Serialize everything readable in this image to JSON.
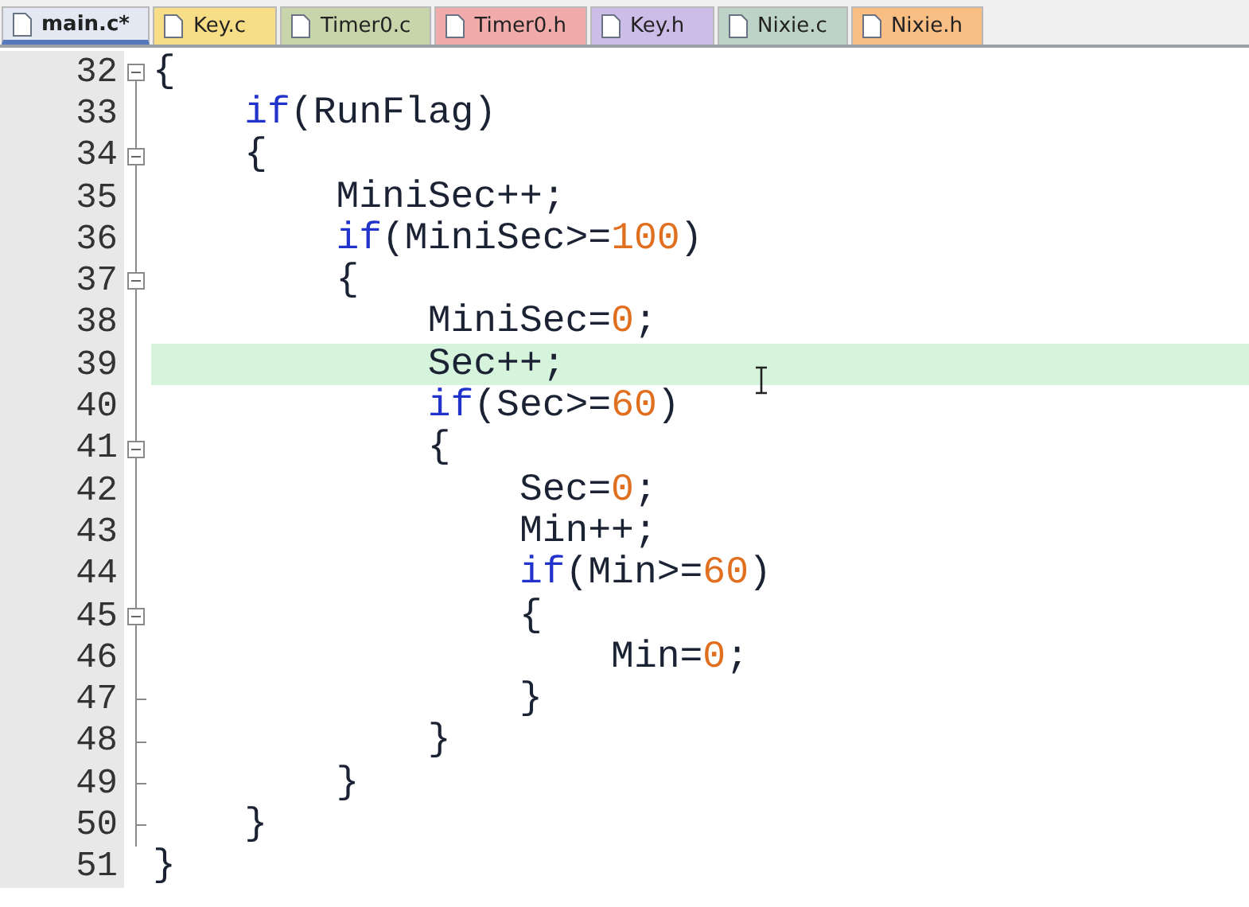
{
  "tabs": [
    {
      "label": "main.c*",
      "color": "#e3e8f3",
      "selected": true
    },
    {
      "label": "Key.c",
      "color": "#f7de86",
      "selected": false
    },
    {
      "label": "Timer0.c",
      "color": "#c8d5ab",
      "selected": false
    },
    {
      "label": "Timer0.h",
      "color": "#f2abab",
      "selected": false
    },
    {
      "label": "Key.h",
      "color": "#cbbde8",
      "selected": false
    },
    {
      "label": "Nixie.c",
      "color": "#bdd3c8",
      "selected": false
    },
    {
      "label": "Nixie.h",
      "color": "#f8be84",
      "selected": false
    }
  ],
  "editor": {
    "lines": [
      {
        "number": "32",
        "kind": "open",
        "highlighted": false,
        "tokens": [
          {
            "kind": "text",
            "text": "{"
          }
        ]
      },
      {
        "number": "33",
        "kind": "inside",
        "highlighted": false,
        "tokens": [
          {
            "kind": "kw",
            "text": "    if"
          },
          {
            "kind": "text",
            "text": "(RunFlag)"
          }
        ]
      },
      {
        "number": "34",
        "kind": "open",
        "highlighted": false,
        "tokens": [
          {
            "kind": "text",
            "text": "    {"
          }
        ]
      },
      {
        "number": "35",
        "kind": "inside",
        "highlighted": false,
        "tokens": [
          {
            "kind": "text",
            "text": "        MiniSec++;"
          }
        ]
      },
      {
        "number": "36",
        "kind": "inside",
        "highlighted": false,
        "tokens": [
          {
            "kind": "kw",
            "text": "        if"
          },
          {
            "kind": "text",
            "text": "(MiniSec>="
          },
          {
            "kind": "num",
            "text": "100"
          },
          {
            "kind": "text",
            "text": ")"
          }
        ]
      },
      {
        "number": "37",
        "kind": "open",
        "highlighted": false,
        "tokens": [
          {
            "kind": "text",
            "text": "        {"
          }
        ]
      },
      {
        "number": "38",
        "kind": "inside",
        "highlighted": false,
        "tokens": [
          {
            "kind": "text",
            "text": "            MiniSec="
          },
          {
            "kind": "num",
            "text": "0"
          },
          {
            "kind": "text",
            "text": ";"
          }
        ]
      },
      {
        "number": "39",
        "kind": "inside",
        "highlighted": true,
        "tokens": [
          {
            "kind": "text",
            "text": "            Sec++;"
          }
        ]
      },
      {
        "number": "40",
        "kind": "inside",
        "highlighted": false,
        "tokens": [
          {
            "kind": "kw",
            "text": "            if"
          },
          {
            "kind": "text",
            "text": "(Sec>="
          },
          {
            "kind": "num",
            "text": "60"
          },
          {
            "kind": "text",
            "text": ")"
          }
        ]
      },
      {
        "number": "41",
        "kind": "open",
        "highlighted": false,
        "tokens": [
          {
            "kind": "text",
            "text": "            {"
          }
        ]
      },
      {
        "number": "42",
        "kind": "inside",
        "highlighted": false,
        "tokens": [
          {
            "kind": "text",
            "text": "                Sec="
          },
          {
            "kind": "num",
            "text": "0"
          },
          {
            "kind": "text",
            "text": ";"
          }
        ]
      },
      {
        "number": "43",
        "kind": "inside",
        "highlighted": false,
        "tokens": [
          {
            "kind": "text",
            "text": "                Min++;"
          }
        ]
      },
      {
        "number": "44",
        "kind": "inside",
        "highlighted": false,
        "tokens": [
          {
            "kind": "kw",
            "text": "                if"
          },
          {
            "kind": "text",
            "text": "(Min>="
          },
          {
            "kind": "num",
            "text": "60"
          },
          {
            "kind": "text",
            "text": ")"
          }
        ]
      },
      {
        "number": "45",
        "kind": "open",
        "highlighted": false,
        "tokens": [
          {
            "kind": "text",
            "text": "                {"
          }
        ]
      },
      {
        "number": "46",
        "kind": "inside",
        "highlighted": false,
        "tokens": [
          {
            "kind": "text",
            "text": "                    Min="
          },
          {
            "kind": "num",
            "text": "0"
          },
          {
            "kind": "text",
            "text": ";"
          }
        ]
      },
      {
        "number": "47",
        "kind": "close",
        "highlighted": false,
        "tokens": [
          {
            "kind": "text",
            "text": "                }"
          }
        ]
      },
      {
        "number": "48",
        "kind": "close",
        "highlighted": false,
        "tokens": [
          {
            "kind": "text",
            "text": "            }"
          }
        ]
      },
      {
        "number": "49",
        "kind": "close",
        "highlighted": false,
        "tokens": [
          {
            "kind": "text",
            "text": "        }"
          }
        ]
      },
      {
        "number": "50",
        "kind": "close",
        "highlighted": false,
        "tokens": [
          {
            "kind": "text",
            "text": "    }"
          }
        ]
      },
      {
        "number": "51",
        "kind": "plain",
        "highlighted": false,
        "tokens": [
          {
            "kind": "text",
            "text": "}"
          }
        ]
      }
    ]
  }
}
